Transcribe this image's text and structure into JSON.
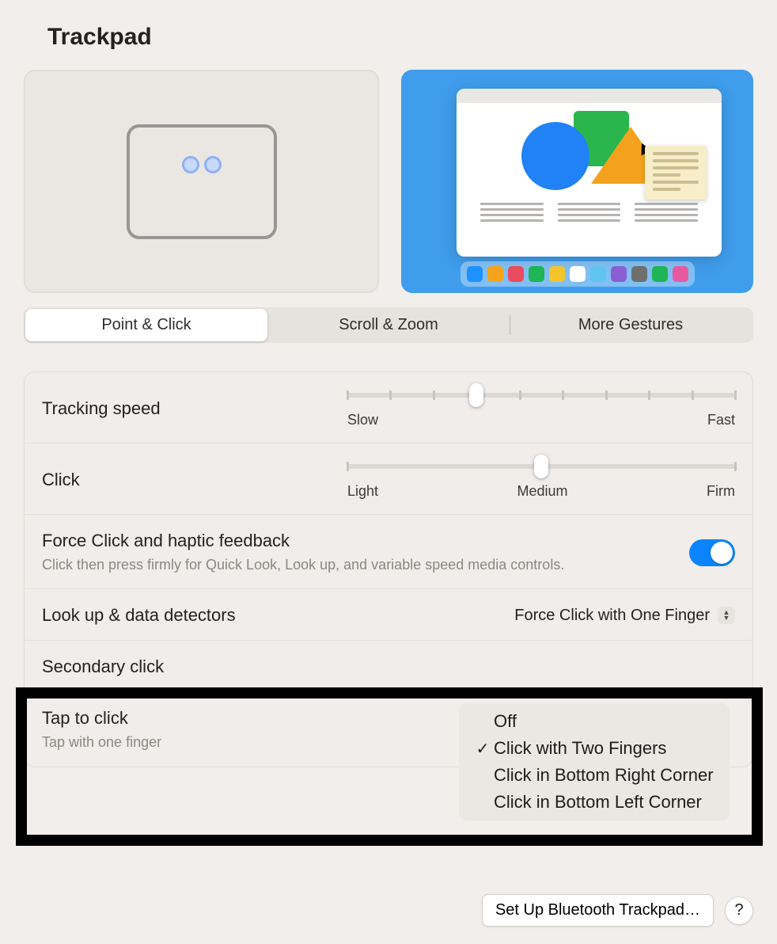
{
  "title": "Trackpad",
  "tabs": {
    "point_click": "Point & Click",
    "scroll_zoom": "Scroll & Zoom",
    "more_gestures": "More Gestures",
    "active": "point_click"
  },
  "dock_colors": [
    "#1f90ff",
    "#f5a31b",
    "#ea4b5f",
    "#1fb455",
    "#f2c52d",
    "#ffffff",
    "#5fc4ef",
    "#8a5fd3",
    "#6f6f6f",
    "#1fb455",
    "#e85aa0"
  ],
  "tracking_speed": {
    "label": "Tracking speed",
    "min_label": "Slow",
    "max_label": "Fast",
    "ticks": 10,
    "value_index": 3
  },
  "click": {
    "label": "Click",
    "min_label": "Light",
    "mid_label": "Medium",
    "max_label": "Firm",
    "ticks": 3,
    "value_index": 1
  },
  "force_click": {
    "label": "Force Click and haptic feedback",
    "desc": "Click then press firmly for Quick Look, Look up, and variable speed media controls.",
    "on": true
  },
  "lookup": {
    "label": "Look up & data detectors",
    "value": "Force Click with One Finger"
  },
  "secondary_click": {
    "label": "Secondary click",
    "selected_index": 1,
    "options": [
      "Off",
      "Click with Two Fingers",
      "Click in Bottom Right Corner",
      "Click in Bottom Left Corner"
    ]
  },
  "tap_to_click": {
    "label": "Tap to click",
    "desc": "Tap with one finger"
  },
  "bottom": {
    "setup": "Set Up Bluetooth Trackpad…",
    "help": "?"
  }
}
